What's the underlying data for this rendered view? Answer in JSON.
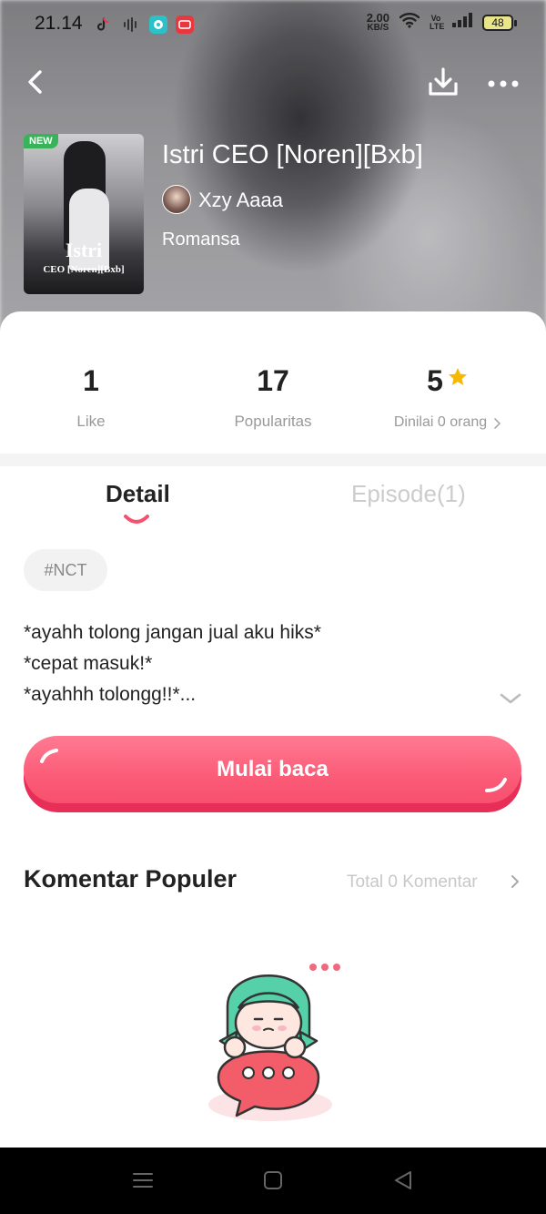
{
  "status_bar": {
    "time": "21.14",
    "net_speed_value": "2.00",
    "net_speed_unit": "KB/S",
    "volte": "Vo LTE",
    "battery": "48"
  },
  "book": {
    "new_badge": "NEW",
    "cover_title": "Istri",
    "cover_subtitle": "CEO [Noren][Bxb]",
    "title": "Istri CEO [Noren][Bxb]",
    "author": "Xzy Aaaa",
    "genre": "Romansa"
  },
  "stats": {
    "likes": {
      "value": "1",
      "label": "Like"
    },
    "popularity": {
      "value": "17",
      "label": "Popularitas"
    },
    "rating": {
      "value": "5",
      "label": "Dinilai 0 orang"
    }
  },
  "tabs": [
    {
      "label": "Detail",
      "active": true
    },
    {
      "label": "Episode(1)",
      "active": false
    }
  ],
  "tag": "#NCT",
  "description": [
    "*ayahh tolong jangan jual aku hiks*",
    "*cepat masuk!*",
    "*ayahhh tolongg!!*..."
  ],
  "start_button": "Mulai baca",
  "comments": {
    "title": "Komentar Populer",
    "total": "Total 0 Komentar"
  },
  "colors": {
    "accent": "#f7506e",
    "accent_dark": "#e72e57",
    "star": "#f6b800",
    "new_badge": "#38b35a"
  },
  "icons": [
    "back-icon",
    "download-icon",
    "more-icon",
    "star-icon",
    "chevron-down-icon",
    "chevron-right-icon",
    "menu-icon",
    "home-icon",
    "back-triangle-icon"
  ]
}
